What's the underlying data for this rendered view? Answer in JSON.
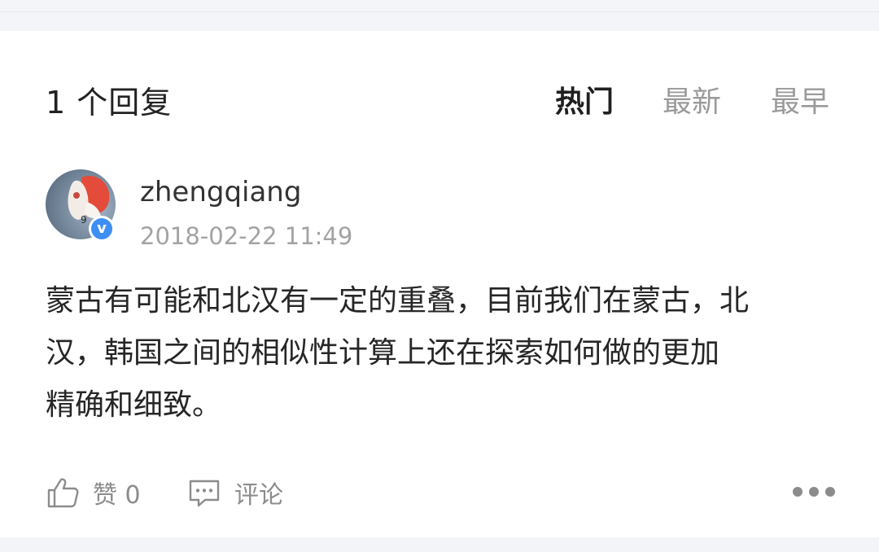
{
  "header": {
    "reply_count": "1 个回复",
    "sort_tabs": [
      {
        "label": "热门",
        "active": true
      },
      {
        "label": "最新",
        "active": false
      },
      {
        "label": "最早",
        "active": false
      }
    ]
  },
  "comment": {
    "avatar_icon": "user-avatar",
    "verified_icon": "v",
    "username": "zhengqiang",
    "timestamp": "2018-02-22 11:49",
    "body_lines": [
      "蒙古有可能和北汉有一定的重叠，目前我们在蒙古，北",
      "汉，韩国之间的相似性计算上还在探索如何做的更加",
      "精确和细致。"
    ]
  },
  "actions": {
    "like_label": "赞 0",
    "comment_label": "评论",
    "like_icon": "thumbs-up-icon",
    "comment_icon": "comment-bubble-icon",
    "more_icon": "more-dots-icon"
  },
  "colors": {
    "text_primary": "#222222",
    "text_secondary": "#9a9a9a",
    "verified_blue": "#3d8ff5",
    "page_background": "#f2f4f7"
  }
}
